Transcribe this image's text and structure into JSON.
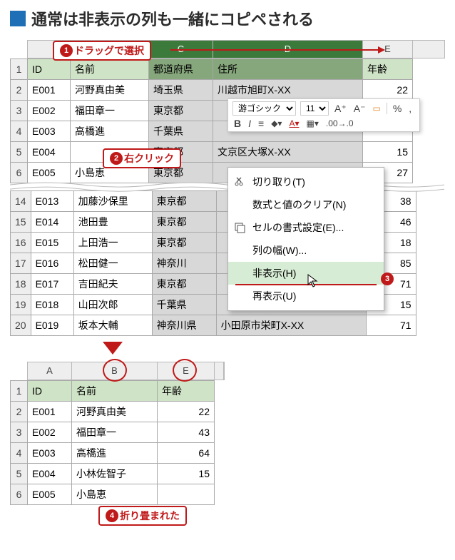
{
  "heading": "通常は非表示の列も一緒にコピペされる",
  "callouts": {
    "c1": {
      "num": "1",
      "text": "ドラッグで選択"
    },
    "c2": {
      "num": "2",
      "text": "右クリック"
    },
    "c3": {
      "num": "3"
    },
    "c4": {
      "num": "4",
      "text": "折り畳まれた"
    }
  },
  "top_columns": {
    "c": "C",
    "d": "D",
    "e": "E"
  },
  "table1": {
    "headers": {
      "id": "ID",
      "name": "名前",
      "pref": "都道府県",
      "addr": "住所",
      "age": "年齢"
    },
    "rows_a": [
      {
        "n": "2",
        "id": "E001",
        "name": "河野真由美",
        "pref": "埼玉県",
        "addr": "川越市旭町X-XX",
        "age": "22"
      },
      {
        "n": "3",
        "id": "E002",
        "name": "福田章一",
        "pref": "東京都",
        "addr": "",
        "age": ""
      },
      {
        "n": "4",
        "id": "E003",
        "name": "高橋進",
        "pref": "千葉県",
        "addr": "",
        "age": ""
      },
      {
        "n": "5",
        "id": "E004",
        "name": "",
        "pref": "東京都",
        "addr": "文京区大塚X-XX",
        "age": "15"
      },
      {
        "n": "6",
        "id": "E005",
        "name": "小島恵",
        "pref": "東京都",
        "addr": "",
        "age": "27"
      }
    ],
    "rows_b": [
      {
        "n": "14",
        "id": "E013",
        "name": "加藤沙保里",
        "pref": "東京都",
        "addr": "",
        "age": "38"
      },
      {
        "n": "15",
        "id": "E014",
        "name": "池田豊",
        "pref": "東京都",
        "addr": "",
        "age": "46"
      },
      {
        "n": "16",
        "id": "E015",
        "name": "上田浩一",
        "pref": "東京都",
        "addr": "",
        "age": "18"
      },
      {
        "n": "17",
        "id": "E016",
        "name": "松田健一",
        "pref": "神奈川",
        "addr": "",
        "age": "85"
      },
      {
        "n": "18",
        "id": "E017",
        "name": "吉田紀夫",
        "pref": "東京都",
        "addr": "",
        "age": "71"
      },
      {
        "n": "19",
        "id": "E018",
        "name": "山田次郎",
        "pref": "千葉県",
        "addr": "",
        "age": "15"
      },
      {
        "n": "20",
        "id": "E019",
        "name": "坂本大輔",
        "pref": "神奈川県",
        "addr": "小田原市栄町X-XX",
        "age": "71"
      }
    ]
  },
  "minitoolbar": {
    "font": "游ゴシック",
    "size": "11",
    "increase": "A⁺",
    "decrease": "A⁻",
    "merge": "▭",
    "percent": "%",
    "bold": "B",
    "italic": "I",
    "align": "≡"
  },
  "context_menu": {
    "cut": "切り取り(T)",
    "clear": "数式と値のクリア(N)",
    "format": "セルの書式設定(E)...",
    "colwidth": "列の幅(W)...",
    "hide": "非表示(H)",
    "unhide": "再表示(U)"
  },
  "bottom_columns": {
    "a": "A",
    "b": "B",
    "e": "E"
  },
  "table2": {
    "headers": {
      "id": "ID",
      "name": "名前",
      "age": "年齢"
    },
    "rows": [
      {
        "n": "2",
        "id": "E001",
        "name": "河野真由美",
        "age": "22"
      },
      {
        "n": "3",
        "id": "E002",
        "name": "福田章一",
        "age": "43"
      },
      {
        "n": "4",
        "id": "E003",
        "name": "高橋進",
        "age": "64"
      },
      {
        "n": "5",
        "id": "E004",
        "name": "小林佐智子",
        "age": "15"
      },
      {
        "n": "6",
        "id": "E005",
        "name": "小島恵",
        "age": ""
      }
    ]
  }
}
